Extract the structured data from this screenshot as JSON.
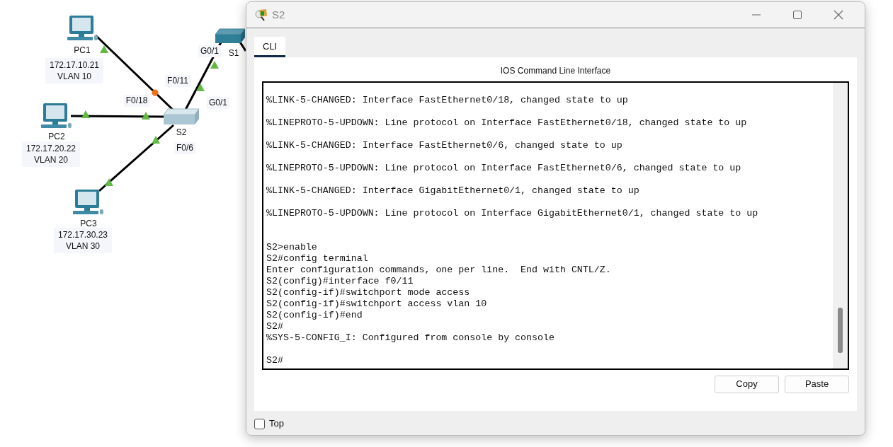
{
  "topology": {
    "devices": [
      {
        "kind": "pc",
        "name": "PC1",
        "ip": "172.17.10.21",
        "vlan": "VLAN 10"
      },
      {
        "kind": "pc",
        "name": "PC2",
        "ip": "172.17.20.22",
        "vlan": "VLAN 20"
      },
      {
        "kind": "pc",
        "name": "PC3",
        "ip": "172.17.30.23",
        "vlan": "VLAN 30"
      },
      {
        "kind": "switch",
        "name": "S2"
      },
      {
        "kind": "switch",
        "name": "S1"
      }
    ],
    "links": [
      {
        "ends": [
          {
            "up": true
          },
          {
            "up": false
          }
        ]
      },
      {
        "ends": [
          {
            "up": true
          },
          {
            "up": true
          }
        ]
      },
      {
        "ends": [
          {
            "up": true
          },
          {
            "up": true
          }
        ]
      },
      {
        "ends": [
          {
            "up": true
          },
          {
            "up": true
          }
        ]
      }
    ],
    "port_labels": [
      "G0/1",
      "F0/11",
      "G0/1",
      "F0/18",
      "F0/6"
    ]
  },
  "window": {
    "title": "S2",
    "tabs": [
      {
        "label": "CLI",
        "selected": true
      }
    ],
    "panel_title": "IOS Command Line Interface",
    "terminal": {
      "lines": [
        {
          "kind": "text",
          "text": "%LINK-5-CHANGED: Interface FastEthernet0/18, changed state to up"
        },
        {
          "kind": "blank"
        },
        {
          "kind": "text",
          "text": "%LINEPROTO-5-UPDOWN: Line protocol on Interface FastEthernet0/18, changed state to up"
        },
        {
          "kind": "blank"
        },
        {
          "kind": "text",
          "text": "%LINK-5-CHANGED: Interface FastEthernet0/6, changed state to up"
        },
        {
          "kind": "blank"
        },
        {
          "kind": "text",
          "text": "%LINEPROTO-5-UPDOWN: Line protocol on Interface FastEthernet0/6, changed state to up"
        },
        {
          "kind": "blank"
        },
        {
          "kind": "text",
          "text": "%LINK-5-CHANGED: Interface GigabitEthernet0/1, changed state to up"
        },
        {
          "kind": "blank"
        },
        {
          "kind": "text",
          "text": "%LINEPROTO-5-UPDOWN: Line protocol on Interface GigabitEthernet0/1, changed state to up"
        },
        {
          "kind": "blank"
        },
        {
          "kind": "blank"
        },
        {
          "kind": "text",
          "text": "S2>enable"
        },
        {
          "kind": "text",
          "text": "S2#config terminal"
        },
        {
          "kind": "text",
          "text": "Enter configuration commands, one per line.  End with CNTL/Z."
        },
        {
          "kind": "text",
          "text": "S2(config)#interface f0/11"
        },
        {
          "kind": "text",
          "text": "S2(config-if)#switchport mode access"
        },
        {
          "kind": "text",
          "text": "S2(config-if)#switchport access vlan 10"
        },
        {
          "kind": "text",
          "text": "S2(config-if)#end"
        },
        {
          "kind": "text",
          "text": "S2#"
        },
        {
          "kind": "text",
          "text": "%SYS-5-CONFIG_I: Configured from console by console"
        },
        {
          "kind": "blank"
        },
        {
          "kind": "text",
          "text": "S2#"
        }
      ]
    },
    "buttons": [
      "Copy",
      "Paste"
    ],
    "top_checkbox": {
      "label": "Top",
      "checked": false
    }
  }
}
